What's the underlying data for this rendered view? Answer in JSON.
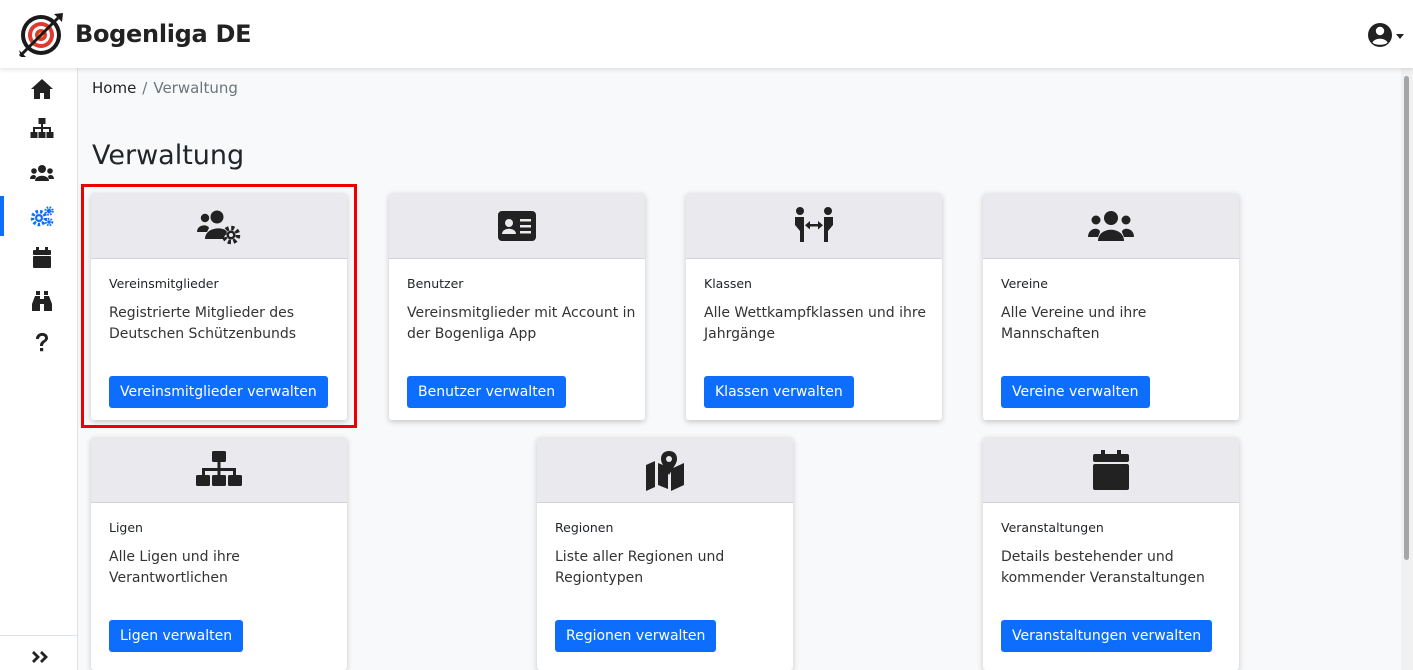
{
  "app": {
    "brand": "Bogenliga DE"
  },
  "header": {
    "user_icon": "user-circle-icon"
  },
  "sidebar": {
    "items": [
      {
        "icon": "home-icon"
      },
      {
        "icon": "sitemap-icon"
      },
      {
        "icon": "users-icon"
      },
      {
        "icon": "cogs-icon",
        "active": true
      },
      {
        "icon": "calendar-icon"
      },
      {
        "icon": "binoculars-icon"
      },
      {
        "icon": "question-icon"
      }
    ],
    "toggle_icon": "double-chevron-right-icon"
  },
  "breadcrumb": {
    "home": "Home",
    "separator": "/",
    "current": "Verwaltung"
  },
  "page": {
    "title": "Verwaltung"
  },
  "cards": [
    {
      "icon": "users-cog-icon",
      "title": "Vereinsmitglieder",
      "text": "Registrierte Mitglieder des Deutschen Schützenbunds",
      "button": "Vereinsmitglieder verwalten"
    },
    {
      "icon": "id-card-icon",
      "title": "Benutzer",
      "text": "Vereinsmitglieder mit Account in der Bogenliga App",
      "button": "Benutzer verwalten"
    },
    {
      "icon": "people-arrows-icon",
      "title": "Klassen",
      "text": "Alle Wettkampfklassen und ihre Jahrgänge",
      "button": "Klassen verwalten"
    },
    {
      "icon": "users-icon",
      "title": "Vereine",
      "text": "Alle Vereine und ihre Mannschaften",
      "button": "Vereine verwalten"
    },
    {
      "icon": "sitemap-icon",
      "title": "Ligen",
      "text": "Alle Ligen und ihre Verantwortlichen",
      "button": "Ligen verwalten"
    },
    {
      "icon": "map-marked-icon",
      "title": "Regionen",
      "text": "Liste aller Regionen und Regiontypen",
      "button": "Regionen verwalten"
    },
    {
      "icon": "calendar-icon",
      "title": "Veranstaltungen",
      "text": "Details bestehender und kommender Veranstaltungen",
      "button": "Veranstaltungen verwalten"
    }
  ],
  "colors": {
    "accent": "#0d6efd",
    "highlight": "#ee0000",
    "header_bg": "#e9e9ee"
  }
}
